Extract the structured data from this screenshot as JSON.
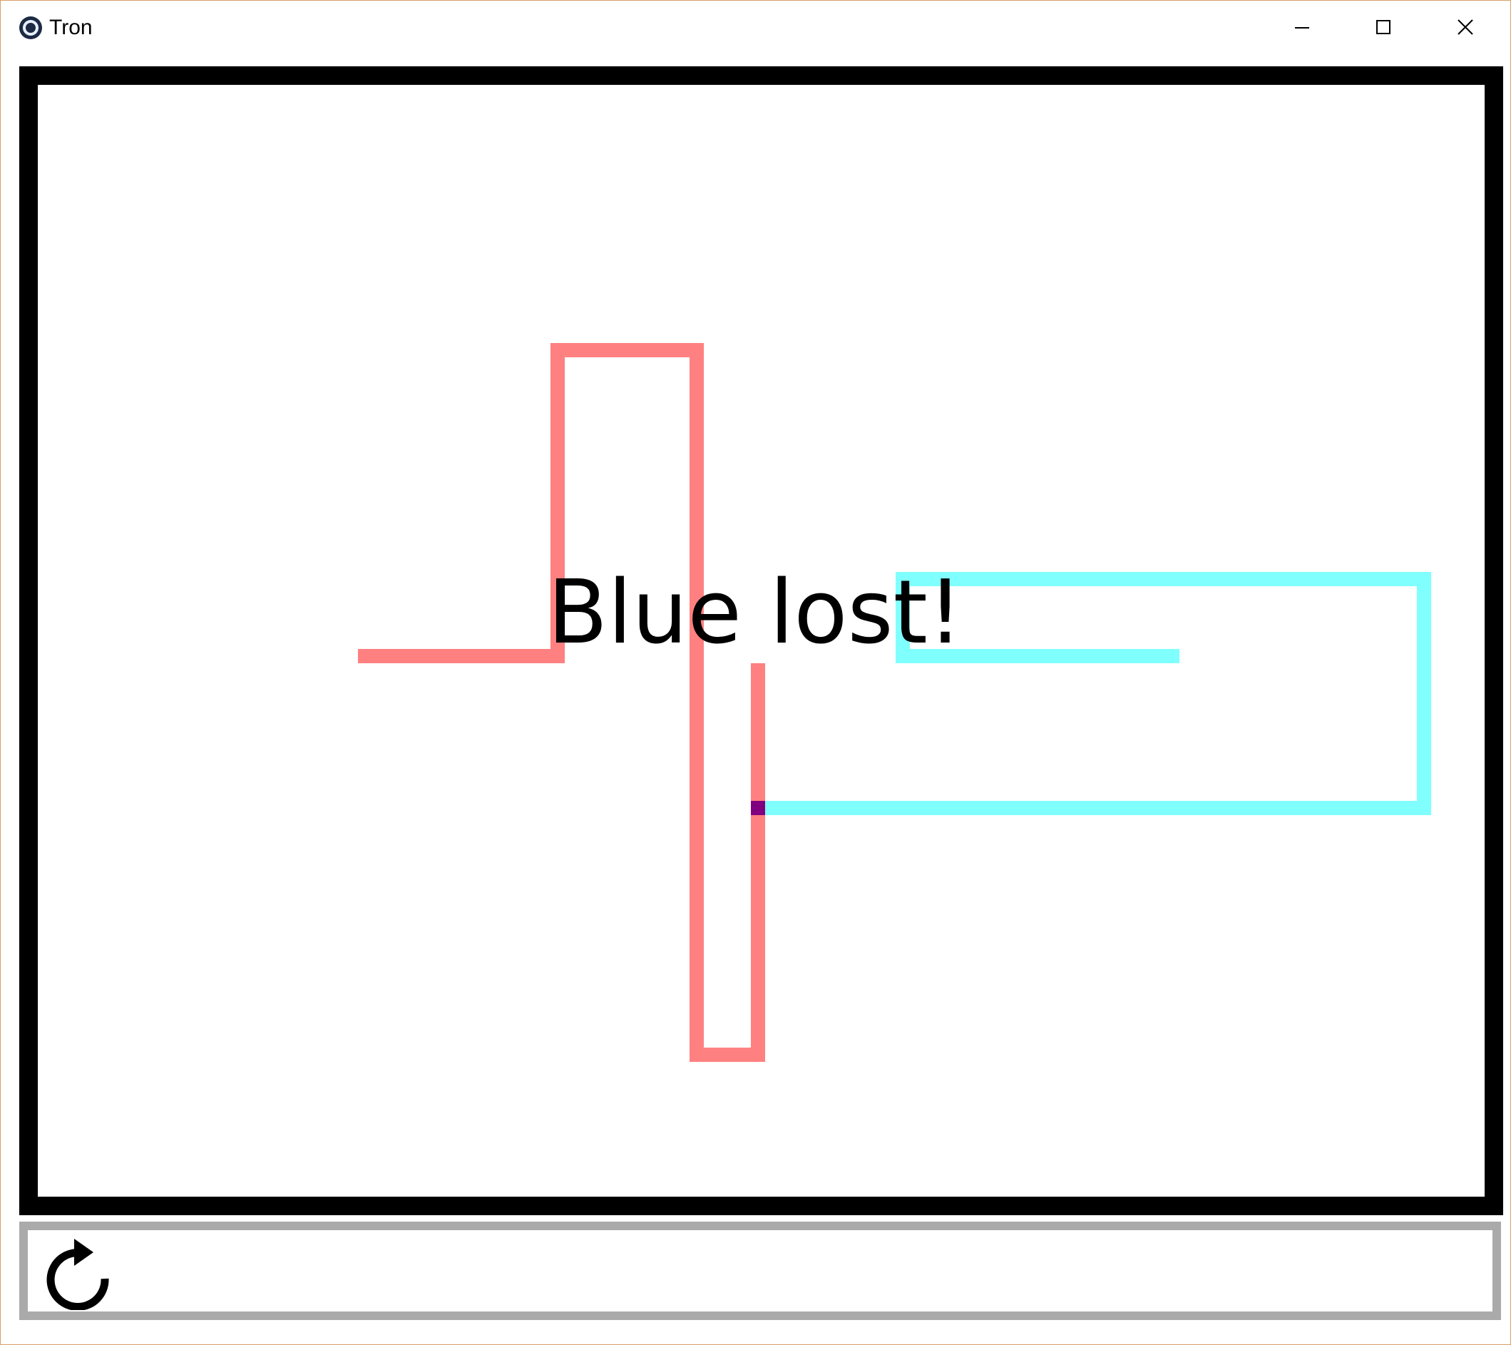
{
  "window": {
    "title": "Tron",
    "icon": "tron-app-icon",
    "controls": [
      "minimize-icon",
      "maximize-icon",
      "close-icon"
    ]
  },
  "game": {
    "message": "Blue lost!",
    "colors": {
      "red_trail": "#ff8080",
      "blue_trail": "#80ffff",
      "collision": "#800080",
      "arena_border": "#000000",
      "arena_background": "#ffffff"
    }
  },
  "controls": {
    "restart_icon": "restart-icon",
    "panel_border_color": "#aaaaaa"
  }
}
